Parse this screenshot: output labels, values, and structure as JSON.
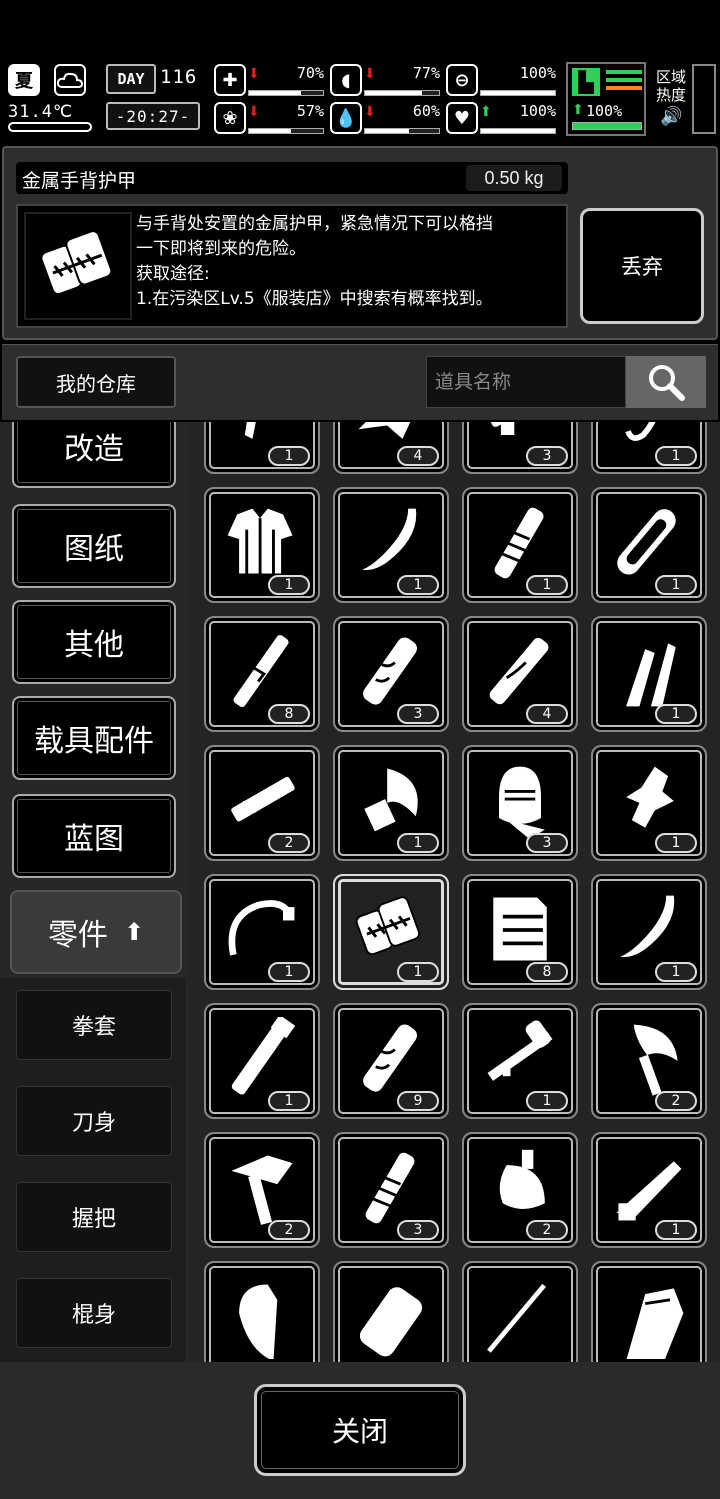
{
  "status": {
    "season": "夏",
    "weather_icon": "cloud-icon",
    "temperature": "31.4℃",
    "day_label": "DAY",
    "day_number": "116",
    "clock": "-20:27-",
    "meters": [
      {
        "name": "health",
        "icon": "medkit-icon",
        "value": "70%",
        "trend": "down",
        "fraction": 0.7
      },
      {
        "name": "hunger",
        "icon": "stomach-icon",
        "value": "77%",
        "trend": "down",
        "fraction": 0.77
      },
      {
        "name": "armor",
        "icon": "helmet-icon",
        "value": "100%",
        "trend": "none",
        "fraction": 1.0
      },
      {
        "name": "sanity",
        "icon": "brain-icon",
        "value": "57%",
        "trend": "down",
        "fraction": 0.57
      },
      {
        "name": "thirst",
        "icon": "water-drop-icon",
        "value": "60%",
        "trend": "down",
        "fraction": 0.6
      },
      {
        "name": "heart",
        "icon": "heart-icon",
        "value": "100%",
        "trend": "up",
        "fraction": 1.0
      }
    ],
    "stamina": "100%",
    "zone_heat_label": "区域热度"
  },
  "item": {
    "name": "金属手背护甲",
    "weight": "0.50 kg",
    "description_lines": [
      "与手背处安置的金属护甲，紧急情况下可以格挡",
      "一下即将到来的危险。",
      "获取途径:",
      "1.在污染区Lv.5《服装店》中搜索有概率找到。"
    ],
    "discard_label": "丢弃"
  },
  "warehouse": {
    "tab_label": "我的仓库",
    "search_placeholder": "道具名称"
  },
  "categories": {
    "main": [
      "改造",
      "图纸",
      "其他",
      "载具配件",
      "蓝图"
    ],
    "active": "零件",
    "sub": [
      "拳套",
      "刀身",
      "握把",
      "棍身"
    ]
  },
  "grid_items": [
    {
      "icon": "lever-part-icon",
      "count": "1"
    },
    {
      "icon": "claw-part-icon",
      "count": "4"
    },
    {
      "icon": "scope-part-icon",
      "count": "3"
    },
    {
      "icon": "hook-part-icon",
      "count": "1"
    },
    {
      "icon": "shirt-icon",
      "count": "1"
    },
    {
      "icon": "curved-blade-icon",
      "count": "1"
    },
    {
      "icon": "wrapped-handle-icon",
      "count": "1"
    },
    {
      "icon": "chainsaw-blade-icon",
      "count": "1"
    },
    {
      "icon": "long-handle-icon",
      "count": "8"
    },
    {
      "icon": "carved-handle-icon",
      "count": "3"
    },
    {
      "icon": "ornate-handle-icon",
      "count": "4"
    },
    {
      "icon": "twin-blade-icon",
      "count": "1"
    },
    {
      "icon": "gun-barrel-icon",
      "count": "2"
    },
    {
      "icon": "axe-head-icon",
      "count": "1"
    },
    {
      "icon": "knight-helmet-icon",
      "count": "3"
    },
    {
      "icon": "ornament-part-icon",
      "count": "1"
    },
    {
      "icon": "bow-frame-icon",
      "count": "1"
    },
    {
      "icon": "metal-hand-guard-icon",
      "count": "1",
      "selected": true
    },
    {
      "icon": "armor-plate-icon",
      "count": "8"
    },
    {
      "icon": "curved-blade-icon",
      "count": "1"
    },
    {
      "icon": "flashlight-handle-icon",
      "count": "1"
    },
    {
      "icon": "carved-handle-icon",
      "count": "9"
    },
    {
      "icon": "rocket-launcher-icon",
      "count": "1"
    },
    {
      "icon": "battle-axe-icon",
      "count": "2"
    },
    {
      "icon": "hatchet-head-icon",
      "count": "2"
    },
    {
      "icon": "wrapped-handle-icon",
      "count": "3"
    },
    {
      "icon": "cleaver-axe-icon",
      "count": "2"
    },
    {
      "icon": "knife-blade-icon",
      "count": "1"
    },
    {
      "icon": "axe-blade-icon",
      "count": ""
    },
    {
      "icon": "bundle-handle-icon",
      "count": ""
    },
    {
      "icon": "rod-icon",
      "count": ""
    },
    {
      "icon": "box-part-icon",
      "count": ""
    }
  ],
  "bottom": {
    "close_label": "关闭"
  }
}
